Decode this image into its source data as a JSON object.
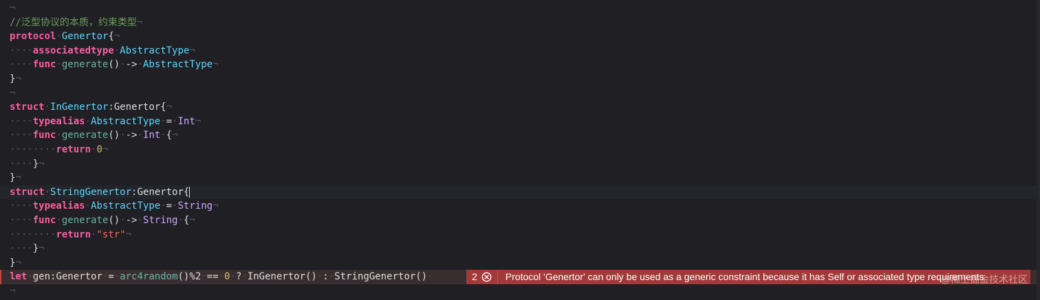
{
  "colors": {
    "background": "#1f1f24",
    "comment": "#6c9d5b",
    "keyword": "#fc5fa3",
    "type_declaration": "#5dd8ff",
    "type_reference": "#d0a8ff",
    "function_call": "#67b7a4",
    "number": "#d0bf69",
    "string": "#fc6a5d",
    "plain": "#dfdfe0",
    "invisibles": "#55575d",
    "error_line": "#382e30",
    "error_badge": "#a13a39"
  },
  "editor": {
    "lines": [
      {
        "tokens": [
          {
            "t": "¬",
            "k": "ws"
          }
        ]
      },
      {
        "tokens": [
          {
            "t": "//泛型协议的本质，约束类型",
            "k": "comment"
          },
          {
            "t": "¬",
            "k": "ws"
          }
        ]
      },
      {
        "tokens": [
          {
            "t": "protocol",
            "k": "kw"
          },
          {
            "t": "·",
            "k": "ws"
          },
          {
            "t": "Genertor",
            "k": "type-decl"
          },
          {
            "t": "{",
            "k": "plain"
          },
          {
            "t": "¬",
            "k": "ws"
          }
        ]
      },
      {
        "tokens": [
          {
            "t": "····",
            "k": "ws"
          },
          {
            "t": "associatedtype",
            "k": "kw"
          },
          {
            "t": "·",
            "k": "ws"
          },
          {
            "t": "AbstractType",
            "k": "type-decl"
          },
          {
            "t": "¬",
            "k": "ws"
          }
        ]
      },
      {
        "tokens": [
          {
            "t": "····",
            "k": "ws"
          },
          {
            "t": "func",
            "k": "kw"
          },
          {
            "t": "·",
            "k": "ws"
          },
          {
            "t": "generate",
            "k": "fn"
          },
          {
            "t": "()",
            "k": "plain"
          },
          {
            "t": "·",
            "k": "ws"
          },
          {
            "t": "->",
            "k": "plain"
          },
          {
            "t": "·",
            "k": "ws"
          },
          {
            "t": "AbstractType",
            "k": "type-decl"
          },
          {
            "t": "¬",
            "k": "ws"
          }
        ]
      },
      {
        "tokens": [
          {
            "t": "}",
            "k": "plain"
          },
          {
            "t": "¬",
            "k": "ws"
          }
        ]
      },
      {
        "tokens": [
          {
            "t": "¬",
            "k": "ws"
          }
        ]
      },
      {
        "tokens": [
          {
            "t": "struct",
            "k": "kw"
          },
          {
            "t": "·",
            "k": "ws"
          },
          {
            "t": "InGenertor",
            "k": "type-decl"
          },
          {
            "t": ":Genertor{",
            "k": "plain"
          },
          {
            "t": "¬",
            "k": "ws"
          }
        ]
      },
      {
        "tokens": [
          {
            "t": "····",
            "k": "ws"
          },
          {
            "t": "typealias",
            "k": "kw"
          },
          {
            "t": "·",
            "k": "ws"
          },
          {
            "t": "AbstractType",
            "k": "type-decl"
          },
          {
            "t": "·",
            "k": "ws"
          },
          {
            "t": "=",
            "k": "plain"
          },
          {
            "t": "·",
            "k": "ws"
          },
          {
            "t": "Int",
            "k": "type"
          },
          {
            "t": "¬",
            "k": "ws"
          }
        ]
      },
      {
        "tokens": [
          {
            "t": "····",
            "k": "ws"
          },
          {
            "t": "func",
            "k": "kw"
          },
          {
            "t": "·",
            "k": "ws"
          },
          {
            "t": "generate",
            "k": "fn"
          },
          {
            "t": "()",
            "k": "plain"
          },
          {
            "t": "·",
            "k": "ws"
          },
          {
            "t": "->",
            "k": "plain"
          },
          {
            "t": "·",
            "k": "ws"
          },
          {
            "t": "Int",
            "k": "type"
          },
          {
            "t": "·",
            "k": "ws"
          },
          {
            "t": "{",
            "k": "plain"
          },
          {
            "t": "¬",
            "k": "ws"
          }
        ]
      },
      {
        "tokens": [
          {
            "t": "········",
            "k": "ws"
          },
          {
            "t": "return",
            "k": "kw"
          },
          {
            "t": "·",
            "k": "ws"
          },
          {
            "t": "0",
            "k": "num"
          },
          {
            "t": "¬",
            "k": "ws"
          }
        ]
      },
      {
        "tokens": [
          {
            "t": "····",
            "k": "ws"
          },
          {
            "t": "}",
            "k": "plain"
          },
          {
            "t": "¬",
            "k": "ws"
          }
        ]
      },
      {
        "tokens": [
          {
            "t": "}",
            "k": "plain"
          },
          {
            "t": "¬",
            "k": "ws"
          }
        ]
      },
      {
        "highlight": true,
        "tokens": [
          {
            "t": "struct",
            "k": "kw"
          },
          {
            "t": "·",
            "k": "ws"
          },
          {
            "t": "StringGenertor",
            "k": "type-decl"
          },
          {
            "t": ":Genertor{",
            "k": "plain"
          },
          {
            "t": "",
            "k": "cursor"
          }
        ]
      },
      {
        "tokens": [
          {
            "t": "····",
            "k": "ws"
          },
          {
            "t": "typealias",
            "k": "kw"
          },
          {
            "t": "·",
            "k": "ws"
          },
          {
            "t": "AbstractType",
            "k": "type-decl"
          },
          {
            "t": "·",
            "k": "ws"
          },
          {
            "t": "=",
            "k": "plain"
          },
          {
            "t": "·",
            "k": "ws"
          },
          {
            "t": "String",
            "k": "type"
          },
          {
            "t": "¬",
            "k": "ws"
          }
        ]
      },
      {
        "tokens": [
          {
            "t": "····",
            "k": "ws"
          },
          {
            "t": "func",
            "k": "kw"
          },
          {
            "t": "·",
            "k": "ws"
          },
          {
            "t": "generate",
            "k": "fn"
          },
          {
            "t": "()",
            "k": "plain"
          },
          {
            "t": "·",
            "k": "ws"
          },
          {
            "t": "->",
            "k": "plain"
          },
          {
            "t": "·",
            "k": "ws"
          },
          {
            "t": "String",
            "k": "type"
          },
          {
            "t": "·",
            "k": "ws"
          },
          {
            "t": "{",
            "k": "plain"
          },
          {
            "t": "¬",
            "k": "ws"
          }
        ]
      },
      {
        "tokens": [
          {
            "t": "········",
            "k": "ws"
          },
          {
            "t": "return",
            "k": "kw"
          },
          {
            "t": "·",
            "k": "ws"
          },
          {
            "t": "\"str\"",
            "k": "str"
          },
          {
            "t": "¬",
            "k": "ws"
          }
        ]
      },
      {
        "tokens": [
          {
            "t": "····",
            "k": "ws"
          },
          {
            "t": "}",
            "k": "plain"
          },
          {
            "t": "¬",
            "k": "ws"
          }
        ]
      },
      {
        "tokens": [
          {
            "t": "}",
            "k": "plain"
          },
          {
            "t": "¬",
            "k": "ws"
          }
        ]
      },
      {
        "error": true,
        "tokens": [
          {
            "t": "let",
            "k": "kw"
          },
          {
            "t": "·",
            "k": "ws"
          },
          {
            "t": "gen:",
            "k": "plain"
          },
          {
            "t": "Genertor",
            "k": "plain"
          },
          {
            "t": "·",
            "k": "ws"
          },
          {
            "t": "=",
            "k": "plain"
          },
          {
            "t": "·",
            "k": "ws"
          },
          {
            "t": "arc4random",
            "k": "fn"
          },
          {
            "t": "()%2",
            "k": "plain"
          },
          {
            "t": "·",
            "k": "ws"
          },
          {
            "t": "==",
            "k": "plain"
          },
          {
            "t": "·",
            "k": "ws"
          },
          {
            "t": "0",
            "k": "num"
          },
          {
            "t": "·",
            "k": "ws"
          },
          {
            "t": "?",
            "k": "plain"
          },
          {
            "t": "·",
            "k": "ws"
          },
          {
            "t": "InGenertor",
            "k": "plain"
          },
          {
            "t": "()",
            "k": "plain"
          },
          {
            "t": "·",
            "k": "ws"
          },
          {
            "t": ":",
            "k": "plain"
          },
          {
            "t": "·",
            "k": "ws"
          },
          {
            "t": "StringGenertor",
            "k": "plain"
          },
          {
            "t": "()",
            "k": "plain"
          },
          {
            "t": "·",
            "k": "ws"
          }
        ]
      },
      {
        "tokens": [
          {
            "t": "¬",
            "k": "ws"
          }
        ]
      }
    ]
  },
  "diagnostic": {
    "count": "2",
    "icon": "error-circle-icon",
    "message": "Protocol 'Genertor' can only be used as a generic constraint because it has Self or associated type requirements"
  },
  "watermark": {
    "text": "@稀土掘金技术社区"
  }
}
